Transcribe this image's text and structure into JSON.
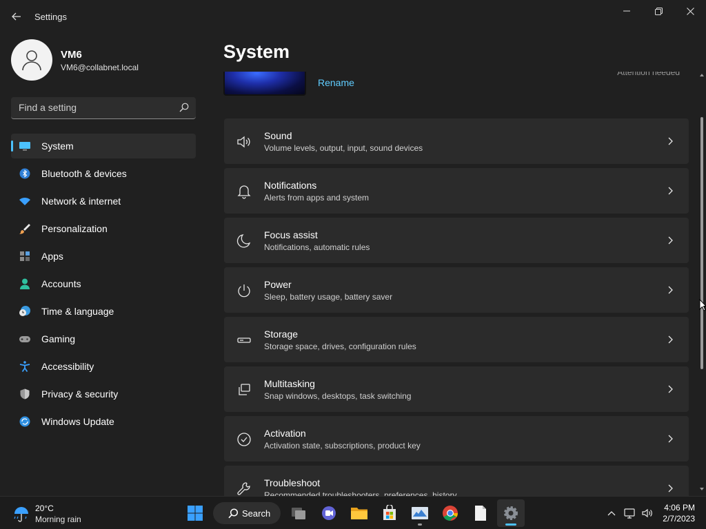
{
  "window": {
    "app_title": "Settings",
    "back_icon": "arrow-left-icon",
    "controls": [
      "minimize-icon",
      "restore-icon",
      "close-icon"
    ]
  },
  "profile": {
    "name": "VM6",
    "email": "VM6@collabnet.local",
    "avatar_icon": "person-icon"
  },
  "search": {
    "placeholder": "Find a setting",
    "icon": "search-icon"
  },
  "nav": {
    "selected": "System",
    "items": [
      {
        "label": "System",
        "icon": "monitor-icon"
      },
      {
        "label": "Bluetooth & devices",
        "icon": "bluetooth-icon"
      },
      {
        "label": "Network & internet",
        "icon": "wifi-icon"
      },
      {
        "label": "Personalization",
        "icon": "brush-icon"
      },
      {
        "label": "Apps",
        "icon": "apps-icon"
      },
      {
        "label": "Accounts",
        "icon": "person-icon"
      },
      {
        "label": "Time & language",
        "icon": "clock-globe-icon"
      },
      {
        "label": "Gaming",
        "icon": "gamepad-icon"
      },
      {
        "label": "Accessibility",
        "icon": "accessibility-icon"
      },
      {
        "label": "Privacy & security",
        "icon": "shield-icon"
      },
      {
        "label": "Windows Update",
        "icon": "sync-icon"
      }
    ]
  },
  "main": {
    "page_title": "System",
    "device": {
      "rename_label": "Rename",
      "attention_text": "Attention needed"
    },
    "cards": [
      {
        "title": "Sound",
        "desc": "Volume levels, output, input, sound devices",
        "icon": "speaker-icon"
      },
      {
        "title": "Notifications",
        "desc": "Alerts from apps and system",
        "icon": "bell-icon"
      },
      {
        "title": "Focus assist",
        "desc": "Notifications, automatic rules",
        "icon": "moon-icon"
      },
      {
        "title": "Power",
        "desc": "Sleep, battery usage, battery saver",
        "icon": "power-icon"
      },
      {
        "title": "Storage",
        "desc": "Storage space, drives, configuration rules",
        "icon": "drive-icon"
      },
      {
        "title": "Multitasking",
        "desc": "Snap windows, desktops, task switching",
        "icon": "multitask-icon"
      },
      {
        "title": "Activation",
        "desc": "Activation state, subscriptions, product key",
        "icon": "check-circle-icon"
      },
      {
        "title": "Troubleshoot",
        "desc": "Recommended troubleshooters, preferences, history",
        "icon": "wrench-icon"
      }
    ]
  },
  "taskbar": {
    "weather": {
      "temp": "20°C",
      "desc": "Morning rain",
      "icon": "rain-umbrella-icon"
    },
    "search_label": "Search",
    "apps": [
      "windows-start-icon",
      "task-view-icon",
      "teams-chat-icon",
      "file-explorer-icon",
      "microsoft-store-icon",
      "photos-icon",
      "chrome-icon",
      "notepad-icon",
      "settings-gear-icon"
    ],
    "tray_icons": [
      "chevron-up-icon",
      "network-monitor-icon",
      "volume-icon"
    ],
    "time": "4:06 PM",
    "date": "2/7/2023"
  },
  "colors": {
    "background": "#202020",
    "accent": "#4cc2ff",
    "link": "#60cdff",
    "card": "#2b2b2b"
  }
}
